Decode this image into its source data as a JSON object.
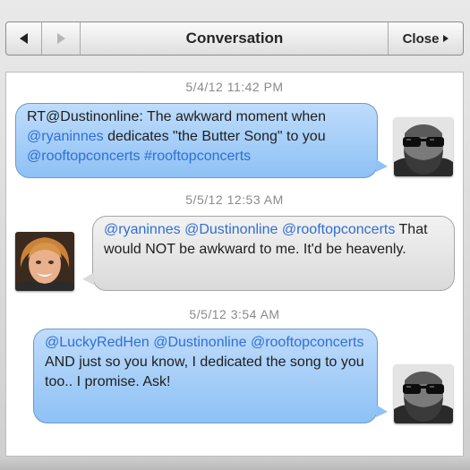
{
  "toolbar": {
    "back_icon": "left-arrow-icon",
    "forward_icon": "right-arrow-icon",
    "title": "Conversation",
    "close_label": "Close"
  },
  "messages": [
    {
      "timestamp": "5/4/12 11:42 PM",
      "side": "right",
      "style": "blue",
      "parts": [
        {
          "t": "RT@Dustinonline: The awkward moment when ",
          "m": false
        },
        {
          "t": "@ryaninnes",
          "m": true
        },
        {
          "t": " dedicates \"the Butter Song\" to you ",
          "m": false
        },
        {
          "t": "@rooftopconcerts",
          "m": true
        },
        {
          "t": " ",
          "m": false
        },
        {
          "t": "#rooftopconcerts",
          "m": true
        }
      ]
    },
    {
      "timestamp": "5/5/12 12:53 AM",
      "side": "left",
      "style": "gray",
      "parts": [
        {
          "t": "@ryaninnes",
          "m": true
        },
        {
          "t": " ",
          "m": false
        },
        {
          "t": "@Dustinonline",
          "m": true
        },
        {
          "t": " ",
          "m": false
        },
        {
          "t": "@rooftopconcerts",
          "m": true
        },
        {
          "t": " That would NOT be awkward to me. It'd be heavenly.",
          "m": false
        }
      ]
    },
    {
      "timestamp": "5/5/12 3:54 AM",
      "side": "right",
      "style": "blue",
      "parts": [
        {
          "t": "@LuckyRedHen",
          "m": true
        },
        {
          "t": " ",
          "m": false
        },
        {
          "t": "@Dustinonline",
          "m": true
        },
        {
          "t": " ",
          "m": false
        },
        {
          "t": "@rooftopconcerts",
          "m": true
        },
        {
          "t": " AND just so you know, I dedicated the song to you too.. I promise. Ask!",
          "m": false
        }
      ]
    }
  ],
  "colors": {
    "mention": "#2f6fd4",
    "blue_bubble": "#a7cff8",
    "gray_bubble": "#e6e6e6",
    "timestamp": "#8a8a8a"
  }
}
